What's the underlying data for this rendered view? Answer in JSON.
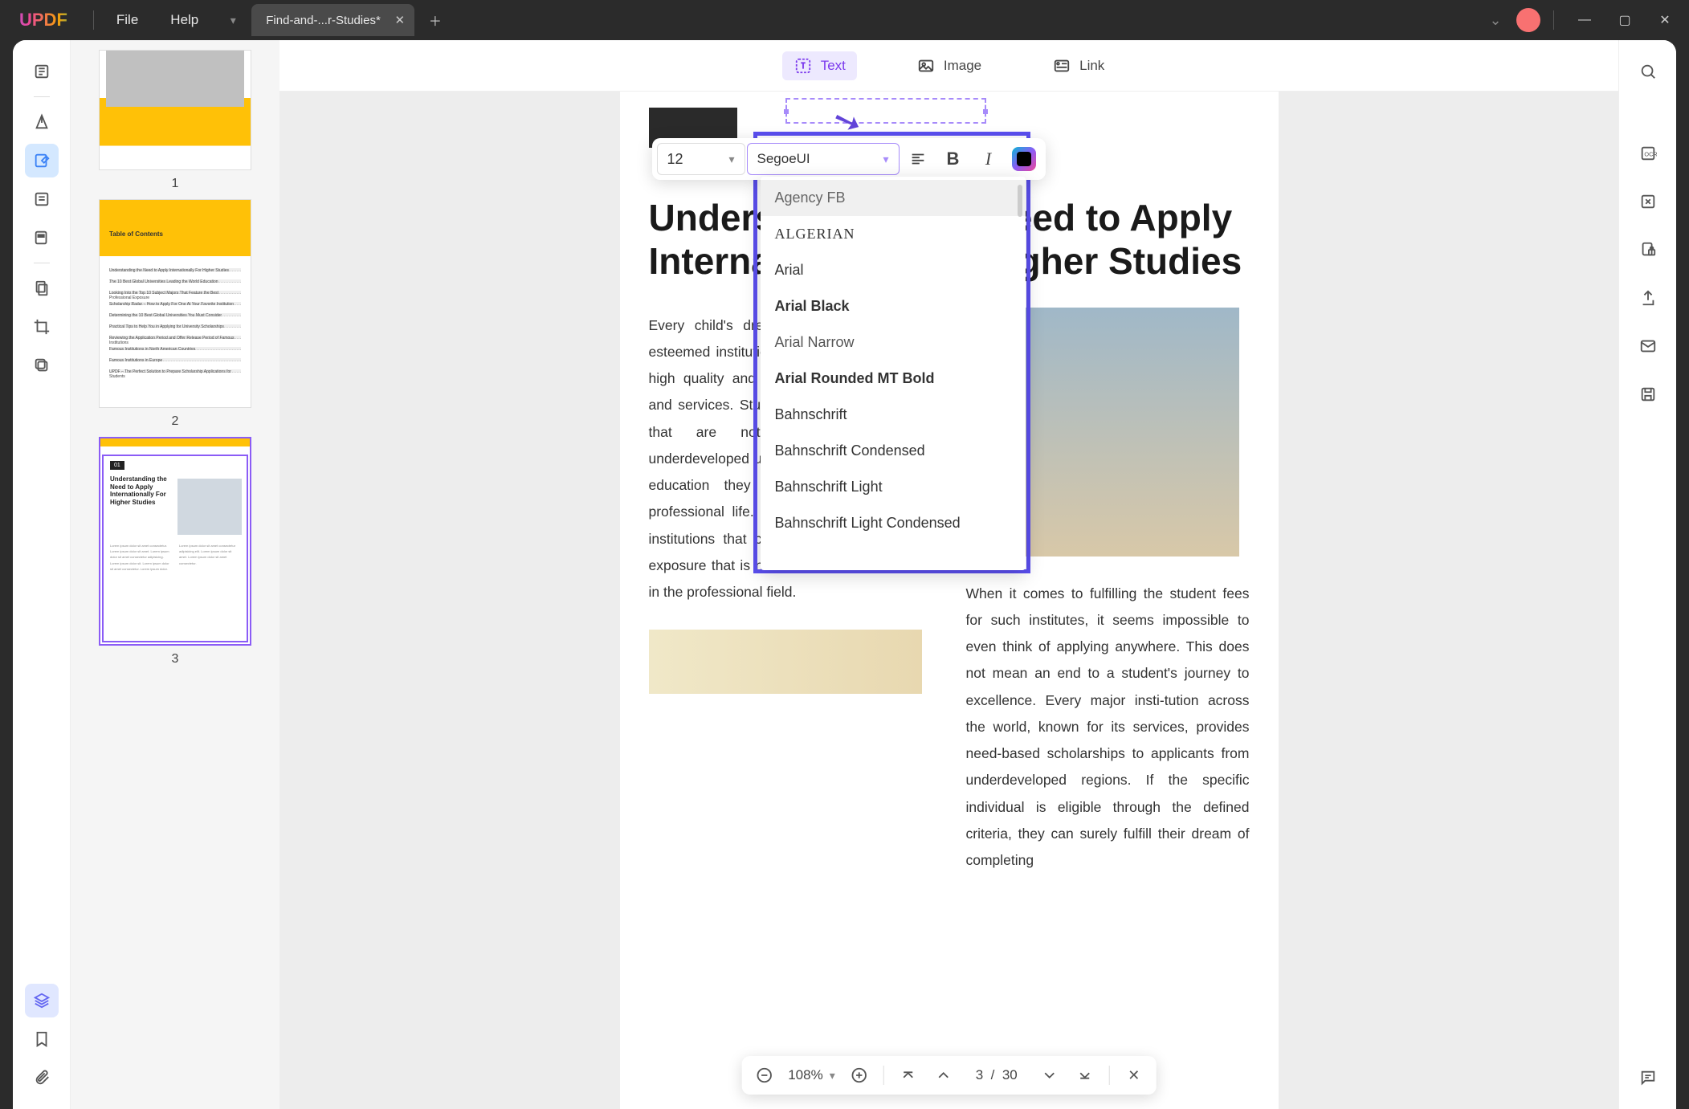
{
  "app": {
    "logo": "UPDF"
  },
  "menu": {
    "file": "File",
    "help": "Help"
  },
  "tab": {
    "title": "Find-and-...r-Studies*"
  },
  "modes": {
    "text": "Text",
    "image": "Image",
    "link": "Link"
  },
  "format": {
    "size": "12",
    "font": "SegoeUI"
  },
  "fonts": {
    "items": [
      {
        "name": "Agency FB",
        "cls": "fi-agency"
      },
      {
        "name": "ALGERIAN",
        "cls": "fi-algerian"
      },
      {
        "name": "Arial",
        "cls": "fi-arial"
      },
      {
        "name": "Arial Black",
        "cls": "fi-arialblack"
      },
      {
        "name": "Arial Narrow",
        "cls": "fi-arialnarrow"
      },
      {
        "name": "Arial Rounded MT Bold",
        "cls": "fi-arialround"
      },
      {
        "name": "Bahnschrift",
        "cls": "fi-bahn"
      },
      {
        "name": "Bahnschrift Condensed",
        "cls": "fi-bahnc"
      },
      {
        "name": "Bahnschrift Light",
        "cls": "fi-bahnl"
      },
      {
        "name": "Bahnschrift Light Condensed",
        "cls": "fi-bahnlc"
      }
    ]
  },
  "thumbs": {
    "p1": "1",
    "p2": "2",
    "p3": "3",
    "toc_title": "Table of Contents",
    "toc_items": [
      "Understanding the Need to Apply Internationally For Higher Studies",
      "The 10 Best Global Universities Leading the World Education",
      "Looking Into the Top 10 Subject Majors That Feature the Best Professional Exposure",
      "Scholarship Radar – How to Apply For One At Your Favorite Institution",
      "Determining the 10 Best Global Universities You Must Consider",
      "Practical Tips to Help You in Applying for University Scholarships",
      "Reviewing the Application Period and Offer Release Period of Famous Institutions",
      "Famous Institutions in North American Countries",
      "Famous Institutions in Europe",
      "UPDF – The Perfect Solution to Prepare Scholarship Applications for Students"
    ],
    "p3_badge": "01",
    "p3_head": "Understanding the Need to Apply Internationally For Higher Studies"
  },
  "page": {
    "heading": "Understanding the Need to Apply Internationally For Higher Studies",
    "col1": "Every child's dream is to be part of an esteemed institution known worldwide for its high quality and fully experienced facilities and services. Students belonging to regions that are not well-established and underdeveloped usually fail to get the quality education they seek to avail in their professional life. Thus, they look for better institutions that can provide them with the exposure that is necessary for them to excel in the professional field.",
    "col2": "When it comes to fulfilling the student fees for such institutes, it seems impossible to even think of applying anywhere. This does not mean an end to a student's journey to excellence. Every major insti-tution across the world, known for its services, provides need-based scholarships to applicants from underdeveloped regions. If the specific individual is eligible through the defined criteria, they can surely fulfill their dream of completing"
  },
  "zoom": {
    "level": "108%"
  },
  "pagenum": {
    "current": "3",
    "sep": "/",
    "total": "30"
  }
}
